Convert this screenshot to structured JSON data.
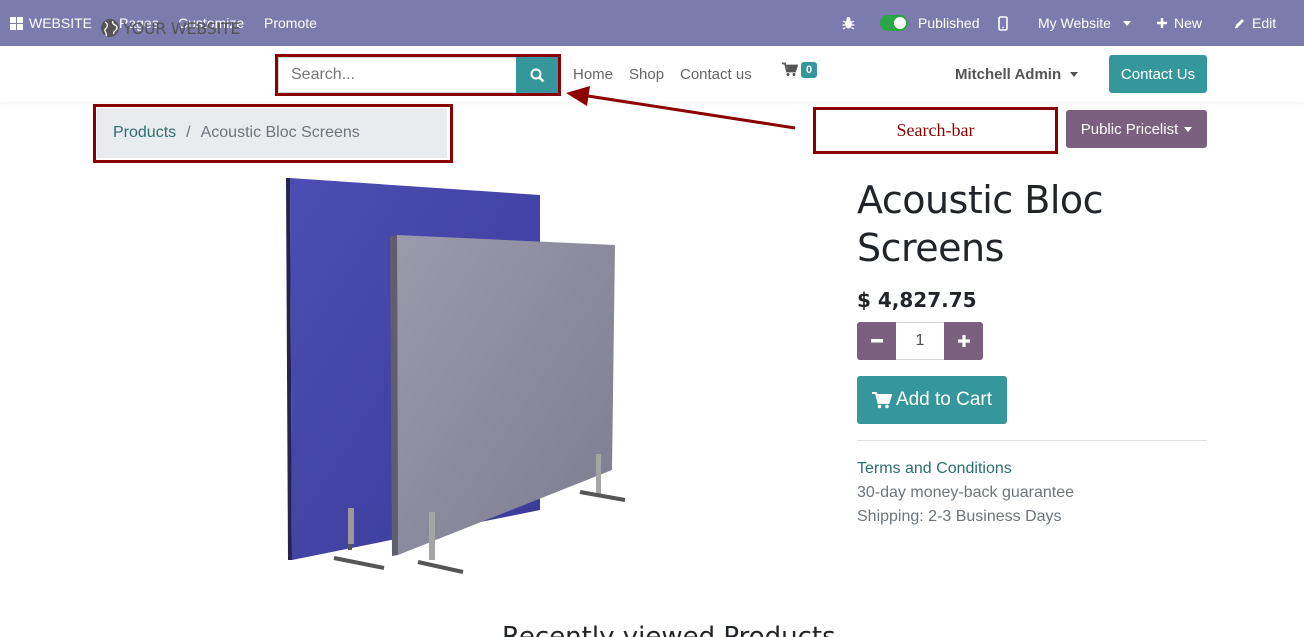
{
  "adminbar": {
    "website_label": "WEBSITE",
    "pages": "Pages",
    "customize": "Customize",
    "promote": "Promote",
    "published": "Published",
    "my_website": "My Website",
    "new": "New",
    "edit": "Edit"
  },
  "header": {
    "logo_text": "YOUR WEBSITE",
    "search_placeholder": "Search...",
    "nav": [
      "Home",
      "Shop",
      "Contact us"
    ],
    "cart_count": "0",
    "user": "Mitchell Admin",
    "contact_button": "Contact Us"
  },
  "breadcrumb": {
    "link": "Products",
    "separator": "/",
    "current": "Acoustic Bloc Screens"
  },
  "annotation": {
    "label": "Search-bar",
    "color": "#8b0000"
  },
  "pricelist": "Public Pricelist",
  "product": {
    "title_line1": "Acoustic Bloc",
    "title_line2": "Screens",
    "price": "$ 4,827.75",
    "quantity": "1",
    "add_to_cart": "Add to Cart",
    "terms": "Terms and Conditions",
    "guarantee": "30-day money-back guarantee",
    "shipping": "Shipping: 2-3 Business Days"
  },
  "recently_viewed": "Recently viewed Products",
  "colors": {
    "adminbar": "#7c7bad",
    "accent": "#35979c",
    "secondary": "#7a5f7e"
  }
}
